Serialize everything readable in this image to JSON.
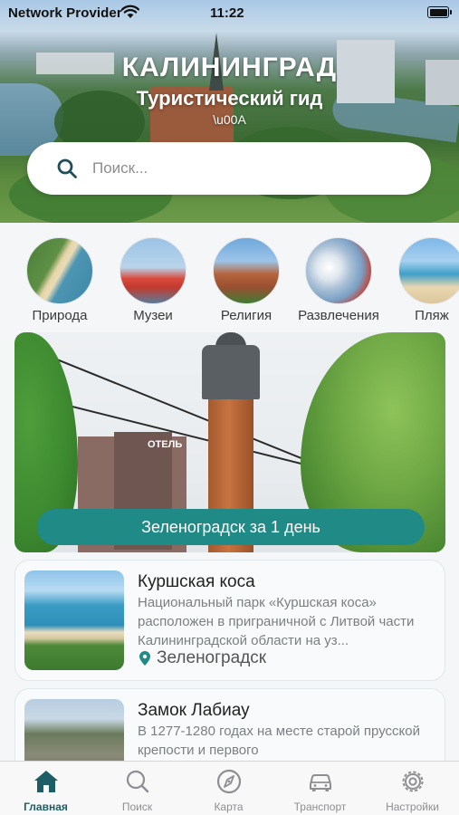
{
  "status_bar": {
    "provider": "Network Provider",
    "time": "11:22"
  },
  "hero": {
    "title": "КАЛИНИНГРАД",
    "subtitle": "Туристический гид",
    "artifact_text": "\\u00A"
  },
  "search": {
    "placeholder": "Поиск..."
  },
  "categories": [
    {
      "label": "Природа",
      "icon": "nature-photo"
    },
    {
      "label": "Музеи",
      "icon": "museum-photo"
    },
    {
      "label": "Религия",
      "icon": "religion-photo"
    },
    {
      "label": "Развлечения",
      "icon": "entertainment-photo"
    },
    {
      "label": "Пляж",
      "icon": "beach-photo"
    }
  ],
  "featured": {
    "button_label": "Зеленоградск за 1 день",
    "sign_text": "ОТЕЛЬ"
  },
  "cards": [
    {
      "title": "Куршская коса",
      "description": "Национальный парк «Куршская коса» расположен в приграничной с Литвой части Калининградской области на уз...",
      "city": "Зеленоградск"
    },
    {
      "title": "Замок Лабиау",
      "description": "В 1277-1280 годах на месте старой прусской крепости и первого",
      "city": ""
    }
  ],
  "tabs": [
    {
      "label": "Главная",
      "icon": "home-icon",
      "active": true
    },
    {
      "label": "Поиск",
      "icon": "search-icon",
      "active": false
    },
    {
      "label": "Карта",
      "icon": "compass-icon",
      "active": false
    },
    {
      "label": "Транспорт",
      "icon": "car-icon",
      "active": false
    },
    {
      "label": "Настройки",
      "icon": "gear-icon",
      "active": false
    }
  ],
  "colors": {
    "accent": "#1f8a86",
    "active_tab": "#1d5d66",
    "inactive_tab": "#8e8e93",
    "background": "#f4f6f8"
  }
}
